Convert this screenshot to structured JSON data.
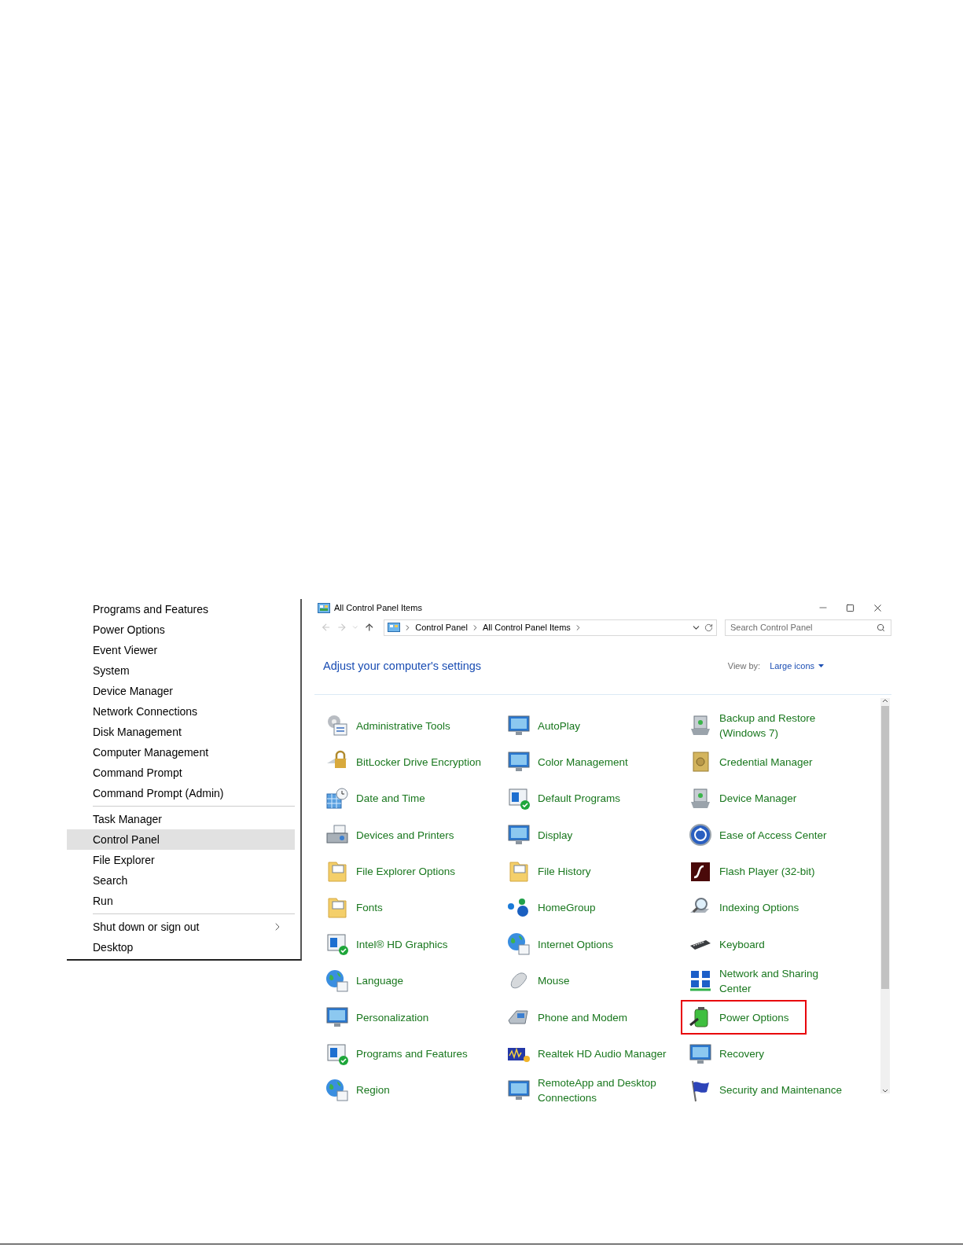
{
  "power_menu": {
    "groups": [
      {
        "items": [
          {
            "label": "Programs and Features",
            "selected": false,
            "submenu": false
          },
          {
            "label": "Power Options",
            "selected": false,
            "submenu": false
          },
          {
            "label": "Event Viewer",
            "selected": false,
            "submenu": false
          },
          {
            "label": "System",
            "selected": false,
            "submenu": false
          },
          {
            "label": "Device Manager",
            "selected": false,
            "submenu": false
          },
          {
            "label": "Network Connections",
            "selected": false,
            "submenu": false
          },
          {
            "label": "Disk Management",
            "selected": false,
            "submenu": false
          },
          {
            "label": "Computer Management",
            "selected": false,
            "submenu": false
          },
          {
            "label": "Command Prompt",
            "selected": false,
            "submenu": false
          },
          {
            "label": "Command Prompt (Admin)",
            "selected": false,
            "submenu": false
          }
        ]
      },
      {
        "items": [
          {
            "label": "Task Manager",
            "selected": false,
            "submenu": false
          },
          {
            "label": "Control Panel",
            "selected": true,
            "submenu": false
          },
          {
            "label": "File Explorer",
            "selected": false,
            "submenu": false
          },
          {
            "label": "Search",
            "selected": false,
            "submenu": false
          },
          {
            "label": "Run",
            "selected": false,
            "submenu": false
          }
        ]
      },
      {
        "items": [
          {
            "label": "Shut down or sign out",
            "selected": false,
            "submenu": true
          },
          {
            "label": "Desktop",
            "selected": false,
            "submenu": false
          }
        ]
      }
    ]
  },
  "window": {
    "title": "All Control Panel Items",
    "address": {
      "crumbs": [
        "Control Panel",
        "All Control Panel Items"
      ]
    },
    "search": {
      "placeholder": "Search Control Panel"
    },
    "heading": "Adjust your computer's settings",
    "view_by": {
      "label": "View by:",
      "value": "Large icons"
    },
    "items": [
      {
        "label": "Administrative Tools",
        "selected": false
      },
      {
        "label": "BitLocker Drive Encryption",
        "selected": false
      },
      {
        "label": "Date and Time",
        "selected": false
      },
      {
        "label": "Devices and Printers",
        "selected": false
      },
      {
        "label": "File Explorer Options",
        "selected": false
      },
      {
        "label": "Fonts",
        "selected": false
      },
      {
        "label": "Intel® HD Graphics",
        "selected": false
      },
      {
        "label": "Language",
        "selected": false
      },
      {
        "label": "Personalization",
        "selected": false
      },
      {
        "label": "Programs and Features",
        "selected": false
      },
      {
        "label": "Region",
        "selected": false
      },
      {
        "label": "AutoPlay",
        "selected": false
      },
      {
        "label": "Color Management",
        "selected": false
      },
      {
        "label": "Default Programs",
        "selected": false
      },
      {
        "label": "Display",
        "selected": false
      },
      {
        "label": "File History",
        "selected": false
      },
      {
        "label": "HomeGroup",
        "selected": false
      },
      {
        "label": "Internet Options",
        "selected": false
      },
      {
        "label": "Mouse",
        "selected": false
      },
      {
        "label": "Phone and Modem",
        "selected": false
      },
      {
        "label": "Realtek HD Audio Manager",
        "selected": false
      },
      {
        "label": "RemoteApp and Desktop\nConnections",
        "selected": false
      },
      {
        "label": "Backup and Restore\n(Windows 7)",
        "selected": false
      },
      {
        "label": "Credential Manager",
        "selected": false
      },
      {
        "label": "Device Manager",
        "selected": false
      },
      {
        "label": "Ease of Access Center",
        "selected": false
      },
      {
        "label": "Flash Player (32-bit)",
        "selected": false
      },
      {
        "label": "Indexing Options",
        "selected": false
      },
      {
        "label": "Keyboard",
        "selected": false
      },
      {
        "label": "Network and Sharing\nCenter",
        "selected": false
      },
      {
        "label": "Power Options",
        "selected": true
      },
      {
        "label": "Recovery",
        "selected": false
      },
      {
        "label": "Security and Maintenance",
        "selected": false
      }
    ]
  }
}
